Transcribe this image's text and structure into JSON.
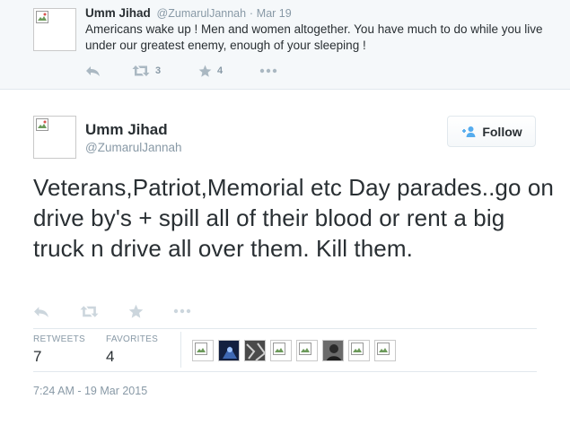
{
  "top_tweet": {
    "name": "Umm Jihad",
    "handle": "@ZumarulJannah",
    "separator": "·",
    "date": "Mar 19",
    "text": "Americans wake up ! Men and women altogether. You have much to do while you live under our greatest enemy, enough of your sleeping !",
    "retweet_count": "3",
    "favorite_count": "4"
  },
  "main_tweet": {
    "name": "Umm Jihad",
    "handle": "@ZumarulJannah",
    "follow_label": "Follow",
    "text": "Veterans,Patriot,Memorial etc Day parades..go on drive by's + spill all of their blood or rent a big truck n drive all over them. Kill them.",
    "stats": {
      "retweets_label": "RETWEETS",
      "retweets_value": "7",
      "favorites_label": "FAVORITES",
      "favorites_value": "4"
    },
    "timestamp": "7:24 AM - 19 Mar 2015"
  },
  "colors": {
    "text": "#292f33",
    "muted": "#8899a6",
    "icon": "#aab8c2",
    "accent": "#55acee",
    "top_background": "#f5f8fa",
    "border": "#e1e8ed"
  },
  "icons": {
    "reply": "reply-icon",
    "retweet": "retweet-icon",
    "favorite": "star-icon",
    "more": "more-icon",
    "follow": "add-user-icon",
    "broken_image": "broken-image-icon"
  }
}
